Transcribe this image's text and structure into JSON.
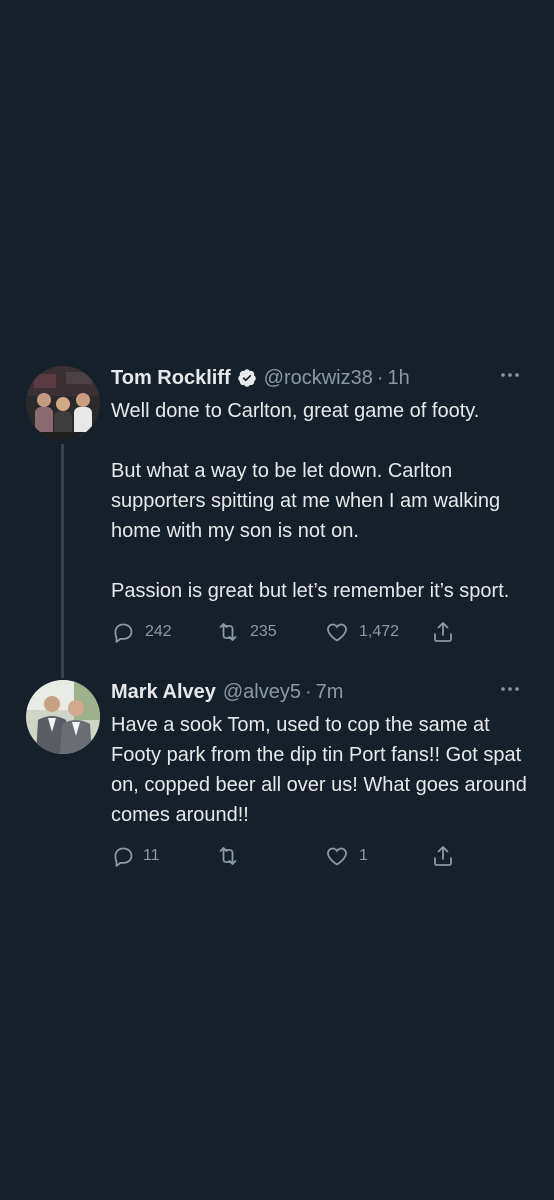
{
  "theme": {
    "background": "#15202b",
    "text": "#e7e9ea",
    "secondary_text": "#8b98a5",
    "thread_line": "#38444d",
    "verified": "#e7e9ea"
  },
  "tweets": [
    {
      "author_name": "Tom Rockliff",
      "verified": true,
      "handle": "@rockwiz38",
      "separator": "·",
      "time": "1h",
      "paragraphs": [
        "Well done to Carlton, great game of footy.",
        "But what a way to be let down. Carlton supporters spitting at me when I am walking home with my son is not on.",
        "Passion is great but let’s remember it’s sport."
      ],
      "replies": "242",
      "retweets": "235",
      "likes": "1,472",
      "icons": [
        "reply-icon",
        "retweet-icon",
        "like-icon",
        "share-icon",
        "more-icon"
      ]
    },
    {
      "author_name": "Mark Alvey",
      "verified": false,
      "handle": "@alvey5",
      "separator": "·",
      "time": "7m",
      "paragraphs": [
        "Have a sook Tom, used to cop the same at Footy park from the dip tin Port fans!! Got spat on, copped beer all over us! What goes around comes around!!"
      ],
      "replies": "11",
      "retweets": "",
      "likes": "1",
      "icons": [
        "reply-icon",
        "retweet-icon",
        "like-icon",
        "share-icon",
        "more-icon"
      ]
    }
  ]
}
